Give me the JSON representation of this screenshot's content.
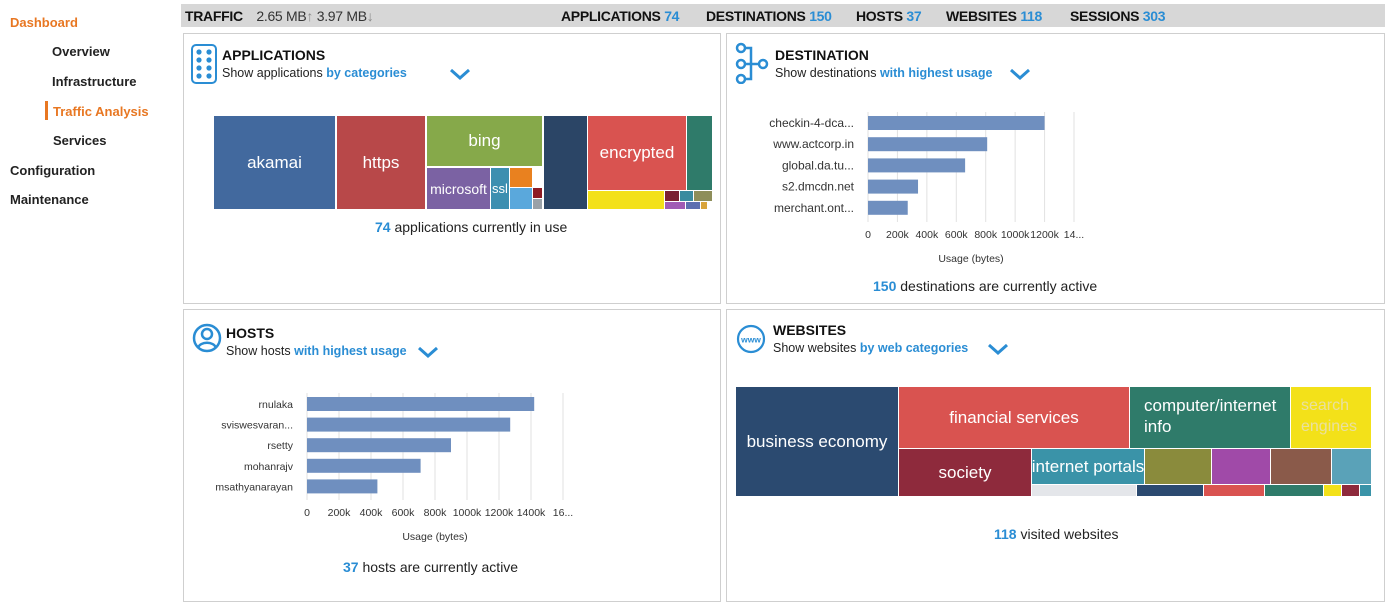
{
  "sidebar": {
    "items": [
      {
        "label": "Dashboard"
      },
      {
        "label": "Overview"
      },
      {
        "label": "Infrastructure"
      },
      {
        "label": "Traffic Analysis"
      },
      {
        "label": "Services"
      },
      {
        "label": "Configuration"
      },
      {
        "label": "Maintenance"
      }
    ]
  },
  "topbar": {
    "traffic_label": "TRAFFIC",
    "traffic_up": "2.65 MB",
    "up_arrow": "↑",
    "traffic_down": "3.97 MB",
    "down_arrow": "↓",
    "applications_label": "APPLICATIONS",
    "applications_value": "74",
    "destinations_label": "DESTINATIONS",
    "destinations_value": "150",
    "hosts_label": "HOSTS",
    "hosts_value": "37",
    "websites_label": "WEBSITES",
    "websites_value": "118",
    "sessions_label": "SESSIONS",
    "sessions_value": "303"
  },
  "applications": {
    "title": "APPLICATIONS",
    "subtitle_prefix": "Show applications",
    "subtitle_option": "by categories",
    "summary_count": "74",
    "summary_text": "applications currently in use",
    "treemap": {
      "akamai": "akamai",
      "https": "https",
      "bing": "bing",
      "microsoft": "microsoft",
      "ssl": "ssl",
      "encrypted": "encrypted"
    }
  },
  "destination": {
    "title": "DESTINATION",
    "subtitle_prefix": "Show destinations",
    "subtitle_option": "with highest usage",
    "summary_count": "150",
    "summary_text": "destinations are currently active"
  },
  "hosts": {
    "title": "HOSTS",
    "subtitle_prefix": "Show hosts",
    "subtitle_option": "with highest usage",
    "summary_count": "37",
    "summary_text": "hosts are currently active"
  },
  "websites": {
    "title": "WEBSITES",
    "subtitle_prefix": "Show websites",
    "subtitle_option": "by web categories",
    "summary_count": "118",
    "summary_text": "visited websites",
    "treemap": {
      "business_economy": "business economy",
      "financial_services": "financial services",
      "computer_internet": "computer/internet info",
      "search_engines": "search engines",
      "society": "society",
      "internet_portals": "internet portals"
    }
  },
  "icons": {
    "applications": "applications-grid-icon",
    "destination": "network-nodes-icon",
    "hosts": "user-circle-icon",
    "websites": "www-globe-icon",
    "dropdown": "chevron-down-icon"
  },
  "colors": {
    "accent_blue": "#2a8dd4",
    "sidebar_orange": "#e87722",
    "bar_fill": "#6f8fbf"
  },
  "chart_data": [
    {
      "type": "bar",
      "orientation": "horizontal",
      "categories": [
        "checkin-4-dca...",
        "www.actcorp.in",
        "global.da.tu...",
        "s2.dmcdn.net",
        "merchant.ont..."
      ],
      "values": [
        1200000,
        810000,
        660000,
        340000,
        270000
      ],
      "xlabel": "Usage (bytes)",
      "xticks": [
        "0",
        "200k",
        "400k",
        "600k",
        "800k",
        "1000k",
        "1200k",
        "14..."
      ],
      "xlim": [
        0,
        1400000
      ],
      "grid": true
    },
    {
      "type": "bar",
      "orientation": "horizontal",
      "categories": [
        "rnulaka",
        "sviswesvaran...",
        "rsetty",
        "mohanrajv",
        "msathyanarayan"
      ],
      "values": [
        1420000,
        1270000,
        900000,
        710000,
        440000
      ],
      "xlabel": "Usage (bytes)",
      "xticks": [
        "0",
        "200k",
        "400k",
        "600k",
        "800k",
        "1000k",
        "1200k",
        "1400k",
        "16..."
      ],
      "xlim": [
        0,
        1600000
      ],
      "grid": true
    }
  ]
}
